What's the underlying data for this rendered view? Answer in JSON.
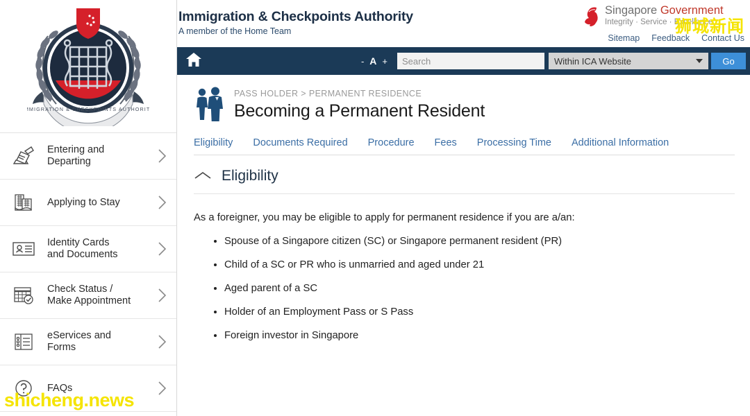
{
  "sidebar": {
    "logo": {
      "name": "ica-crest-logo",
      "ribbon_text": "IMMIGRATION & CHECKPOINTS AUTHORITY"
    },
    "items": [
      {
        "label": "Entering and\nDeparting",
        "icon": "passport-stamp-icon",
        "chevron": "chevron-right-icon"
      },
      {
        "label": "Applying to Stay",
        "icon": "buildings-icon",
        "chevron": "chevron-right-icon"
      },
      {
        "label": "Identity Cards\nand Documents",
        "icon": "id-card-icon",
        "chevron": "chevron-right-icon"
      },
      {
        "label": "Check Status /\nMake Appointment",
        "icon": "calendar-check-icon",
        "chevron": "chevron-right-icon"
      },
      {
        "label": "eServices and\nForms",
        "icon": "checklist-icon",
        "chevron": "chevron-right-icon"
      },
      {
        "label": "FAQs",
        "icon": "question-mark-icon",
        "chevron": "chevron-right-icon"
      }
    ]
  },
  "masthead": {
    "title": "Immigration & Checkpoints Authority",
    "subtitle": "A member of the Home Team",
    "sg_logo": {
      "icon": "singapore-lion-icon",
      "word_singapore": "Singapore ",
      "word_government": "Government",
      "tagline": "Integrity · Service · Excellence"
    },
    "links": [
      {
        "label": "Sitemap"
      },
      {
        "label": "Feedback"
      },
      {
        "label": "Contact Us"
      }
    ]
  },
  "navbar": {
    "home_icon": "home-icon",
    "font_decrease": "-",
    "font_label": "A",
    "font_increase": "+",
    "search": {
      "placeholder": "Search",
      "value": ""
    },
    "scope": {
      "selected": "Within ICA Website",
      "icon": "chevron-down-icon"
    },
    "go_label": "Go"
  },
  "main": {
    "header_icon": "two-people-icon",
    "breadcrumb": "PASS HOLDER > PERMANENT RESIDENCE",
    "page_title": "Becoming a Permanent Resident",
    "tabs": [
      {
        "label": "Eligibility"
      },
      {
        "label": "Documents Required"
      },
      {
        "label": "Procedure"
      },
      {
        "label": "Fees"
      },
      {
        "label": "Processing Time"
      },
      {
        "label": "Additional Information"
      }
    ],
    "section": {
      "toggle_icon": "chevron-up-icon",
      "title": "Eligibility",
      "intro": "As a foreigner, you may be eligible to apply for permanent residence if you are a/an:",
      "bullets": [
        {
          "text": "Spouse of a Singapore citizen (SC) or Singapore permanent resident (PR)"
        },
        {
          "text": "Child of a SC or PR who is unmarried and aged under 21"
        },
        {
          "text": "Aged parent of a SC"
        },
        {
          "text": "Holder of an Employment Pass or S Pass"
        },
        {
          "text": "Foreign investor in Singapore"
        }
      ]
    }
  },
  "watermarks": {
    "chinese": "狮城新闻",
    "english": "shicheng.news",
    "color": "#f5e400"
  },
  "colors": {
    "navbar_bg": "#1b3a57",
    "go_button": "#3d8fd8",
    "link_blue": "#3b6ea5",
    "crest_red": "#d5202a",
    "crest_navy": "#1d2b3e"
  }
}
